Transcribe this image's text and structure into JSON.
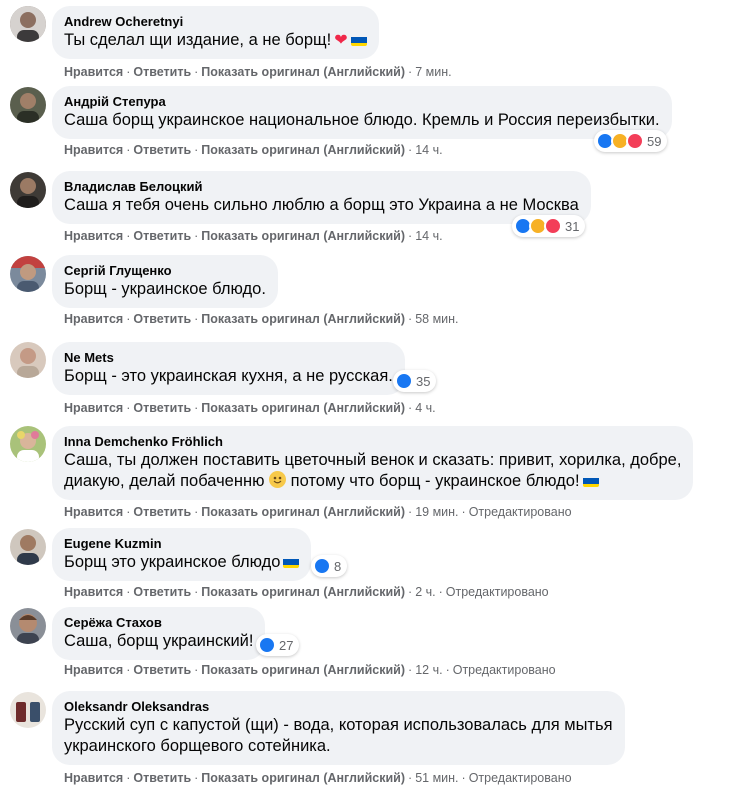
{
  "actions": {
    "like": "Нравится",
    "reply": "Ответить",
    "translate": "Показать оригинал (Английский)",
    "edited": "Отредактировано",
    "sep": "·"
  },
  "comments": [
    {
      "author": "Andrew Ocheretnyi",
      "text": "Ты сделал щи издание, а не борщ!",
      "time": "7 мин."
    },
    {
      "author": "Андрій Степура",
      "text": "Саша борщ украинское национальное блюдо. Кремль и Россия переизбытки.",
      "time": "14 ч.",
      "reactions": "59"
    },
    {
      "author": "Владислав Белоцкий",
      "text": "Саша я тебя очень сильно люблю а борщ это Украина а не Москва",
      "time": "14 ч.",
      "reactions": "31"
    },
    {
      "author": "Сергій Глущенко",
      "text": "Борщ - украинское блюдо.",
      "time": "58 мин."
    },
    {
      "author": "Ne Mets",
      "text": "Борщ - это украинская кухня, а не русская.",
      "time": "4 ч.",
      "reactions": "35"
    },
    {
      "author": "Inna Demchenko Fröhlich",
      "text_line1": "Саша, ты должен поставить цветочный венок и сказать: привит, хорилка, добре,",
      "text_line2a": "диакую, делай побаченню",
      "text_line2b": "потому что борщ - украинское блюдо!",
      "time": "19 мин."
    },
    {
      "author": "Eugene Kuzmin",
      "text": "Борщ это украинское блюдо",
      "time": "2 ч.",
      "reactions": "8"
    },
    {
      "author": "Серёжа Стахов",
      "text": "Саша, борщ украинский!",
      "time": "12 ч.",
      "reactions": "27"
    },
    {
      "author": "Oleksandr Oleksandras",
      "text_line1": "Русский суп с капустой (щи) - вода, которая использовалась для мытья",
      "text_line2": "украинского борщевого сотейника.",
      "time": "51 мин."
    }
  ],
  "icons": {
    "like": "like-reaction-icon",
    "haha": "haha-reaction-icon",
    "love": "love-reaction-icon",
    "heart": "red-heart-emoji",
    "flag": "ukraine-flag-emoji",
    "smile": "smile-emoji"
  },
  "colors": {
    "bubble": "#f0f2f5",
    "meta": "#65676b",
    "like_blue": "#1877f2",
    "love_red": "#f33e58",
    "haha_yellow": "#f7b125",
    "flag_blue": "#0057b7",
    "flag_yellow": "#ffd700"
  }
}
